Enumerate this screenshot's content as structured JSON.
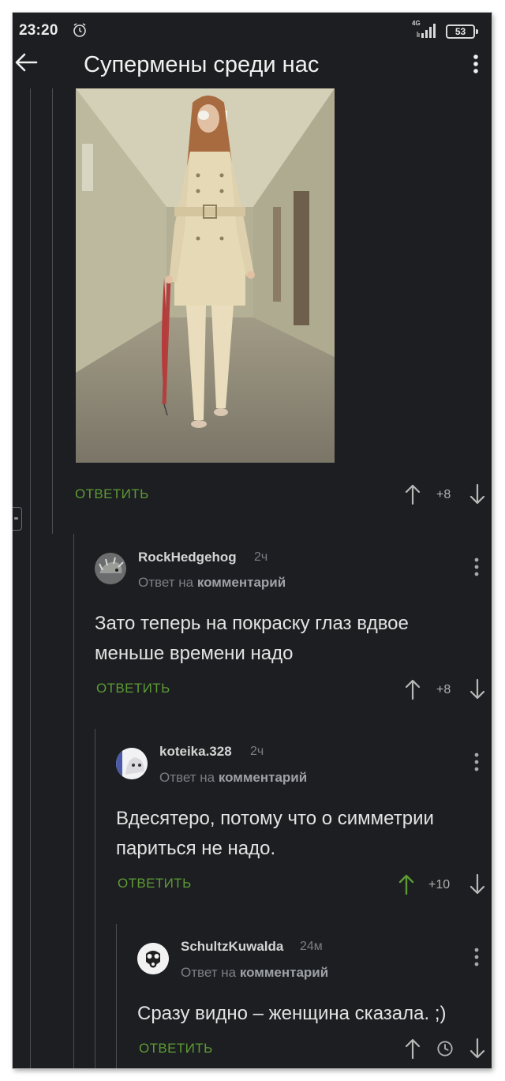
{
  "status_bar": {
    "time": "23:20",
    "network": "4G",
    "battery": "53",
    "alarm_icon": "alarm-icon",
    "signal_icon": "signal-icon"
  },
  "header": {
    "title": "Супермены среди нас",
    "back_icon": "arrow-left-icon",
    "menu_icon": "more-vertical-icon"
  },
  "post": {
    "reply_label": "ОТВЕТИТЬ",
    "votes": "+8"
  },
  "comments": [
    {
      "username": "RockHedgehog",
      "time": "2ч",
      "reply_prefix": "Ответ на",
      "reply_target": "комментарий",
      "text": "Зато теперь на покраску глаз вдвое меньше времени надо",
      "reply_label": "ОТВЕТИТЬ",
      "votes": "+8"
    },
    {
      "username": "koteika.328",
      "time": "2ч",
      "reply_prefix": "Ответ на",
      "reply_target": "комментарий",
      "text": "Вдесятеро, потому что о симметрии париться не надо.",
      "reply_label": "ОТВЕТИТЬ",
      "votes": "+10",
      "upvoted": true
    },
    {
      "username": "SchultzKuwalda",
      "time": "24м",
      "reply_prefix": "Ответ на",
      "reply_target": "комментарий",
      "text": "Сразу видно – женщина сказала. ;)",
      "reply_label": "ОТВЕТИТЬ",
      "votes_icon": "clock-icon"
    }
  ],
  "colors": {
    "background": "#1c1e21",
    "accent_green": "#5d9a35",
    "text": "#e3e3e3",
    "muted": "#7b7e83"
  }
}
